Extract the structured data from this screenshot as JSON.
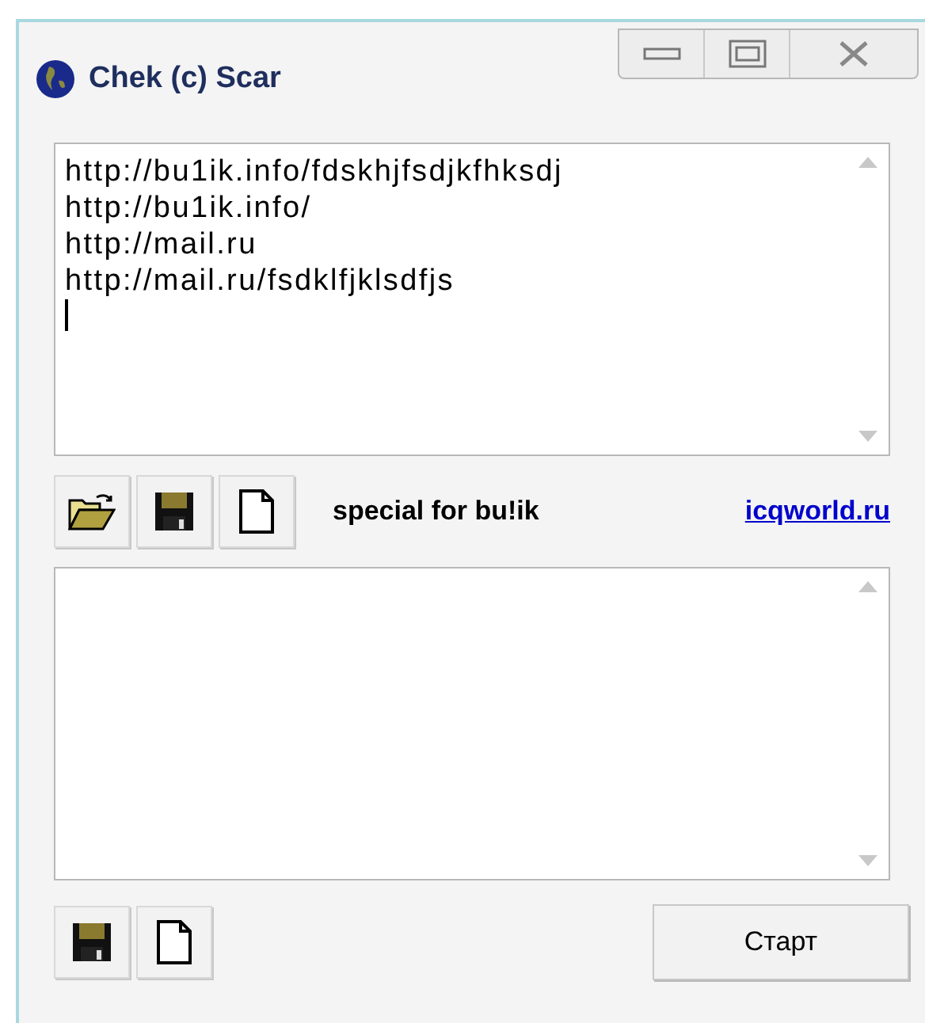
{
  "window": {
    "title": "Chek (c) Scar"
  },
  "url_list": {
    "lines": [
      "http://bu1ik.info/fdskhjfsdjkfhksdj",
      "http://bu1ik.info/",
      "http://mail.ru",
      "http://mail.ru/fsdklfjklsdfjs"
    ]
  },
  "toolbar": {
    "credit": "special for bu!ik",
    "link": "icqworld.ru"
  },
  "start_button": "Старт"
}
